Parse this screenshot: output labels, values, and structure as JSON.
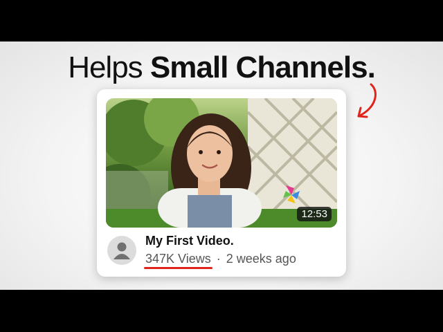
{
  "headline": {
    "light_text": "Helps",
    "bold_text": "Small Channels."
  },
  "video": {
    "duration": "12:53",
    "title": "My First Video.",
    "views": "347K Views",
    "separator": "·",
    "age": "2 weeks ago"
  },
  "colors": {
    "accent_red": "#e0241c",
    "headline": "#111111",
    "meta_text": "#555555"
  },
  "icons": {
    "avatar": "default-user-avatar-icon",
    "arrow": "curved-arrow-icon"
  }
}
